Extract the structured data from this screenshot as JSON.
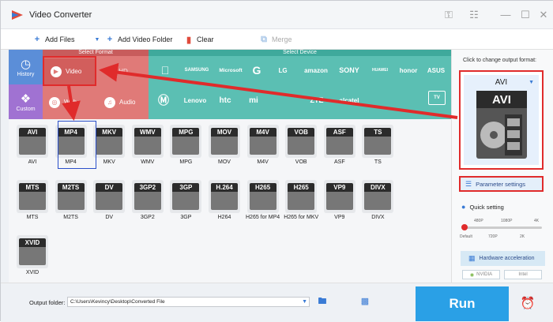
{
  "app": {
    "title": "Video Converter"
  },
  "window_controls": {
    "minimize": "—",
    "maximize": "☐",
    "close": "✕"
  },
  "toolbar": {
    "add_files": "Add Files",
    "add_video_folder": "Add Video Folder",
    "clear": "Clear",
    "merge": "Merge"
  },
  "left_tabs": {
    "history": "History",
    "custom": "Custom"
  },
  "select_format": {
    "header": "Select Format",
    "tiles": [
      "Video",
      "HD",
      "Web",
      "Audio"
    ]
  },
  "select_device": {
    "header": "Select Device",
    "brands": [
      "SAMSUNG",
      "Microsoft",
      "G",
      "LG",
      "amazon",
      "SONY",
      "HUAWEI",
      "honor",
      "ASUS",
      "Lenovo",
      "htc",
      "mi",
      "NOKIA",
      "ZTE",
      "alcatel",
      "TV"
    ]
  },
  "formats": [
    {
      "tag": "AVI",
      "label": "AVI"
    },
    {
      "tag": "MP4",
      "label": "MP4"
    },
    {
      "tag": "MKV",
      "label": "MKV"
    },
    {
      "tag": "WMV",
      "label": "WMV"
    },
    {
      "tag": "MPG",
      "label": "MPG"
    },
    {
      "tag": "MOV",
      "label": "MOV"
    },
    {
      "tag": "M4V",
      "label": "M4V"
    },
    {
      "tag": "VOB",
      "label": "VOB"
    },
    {
      "tag": "ASF",
      "label": "ASF"
    },
    {
      "tag": "TS",
      "label": "TS"
    },
    {
      "tag": "MTS",
      "label": "MTS"
    },
    {
      "tag": "M2TS",
      "label": "M2TS"
    },
    {
      "tag": "DV",
      "label": "DV"
    },
    {
      "tag": "3GP2",
      "label": "3GP2"
    },
    {
      "tag": "3GP",
      "label": "3GP"
    },
    {
      "tag": "H.264",
      "label": "H264"
    },
    {
      "tag": "H265",
      "label": "H265 for MP4"
    },
    {
      "tag": "H265",
      "label": "H265 for MKV"
    },
    {
      "tag": "VP9",
      "label": "VP9"
    },
    {
      "tag": "DIVX",
      "label": "DIVX"
    },
    {
      "tag": "XVID",
      "label": "XVID"
    }
  ],
  "right_panel": {
    "hint": "Click to change output format:",
    "output_format": "AVI",
    "parameter_settings": "Parameter settings",
    "quick_setting": "Quick setting",
    "slider_top_ticks": [
      "480P",
      "1080P",
      "4K"
    ],
    "slider_bottom_ticks": [
      "Default",
      "720P",
      "2K"
    ],
    "hardware_acceleration": "Hardware acceleration",
    "nvidia": "NVIDIA",
    "intel": "Intel"
  },
  "bottom": {
    "output_folder_label": "Output folder:",
    "output_folder_path": "C:\\Users\\Kevincy\\Desktop\\Converted File",
    "run": "Run"
  },
  "colors": {
    "accent_red": "#e02b2b",
    "run_blue": "#2aa0e6",
    "format_red": "#e07a78",
    "device_teal": "#5bbfb3"
  }
}
